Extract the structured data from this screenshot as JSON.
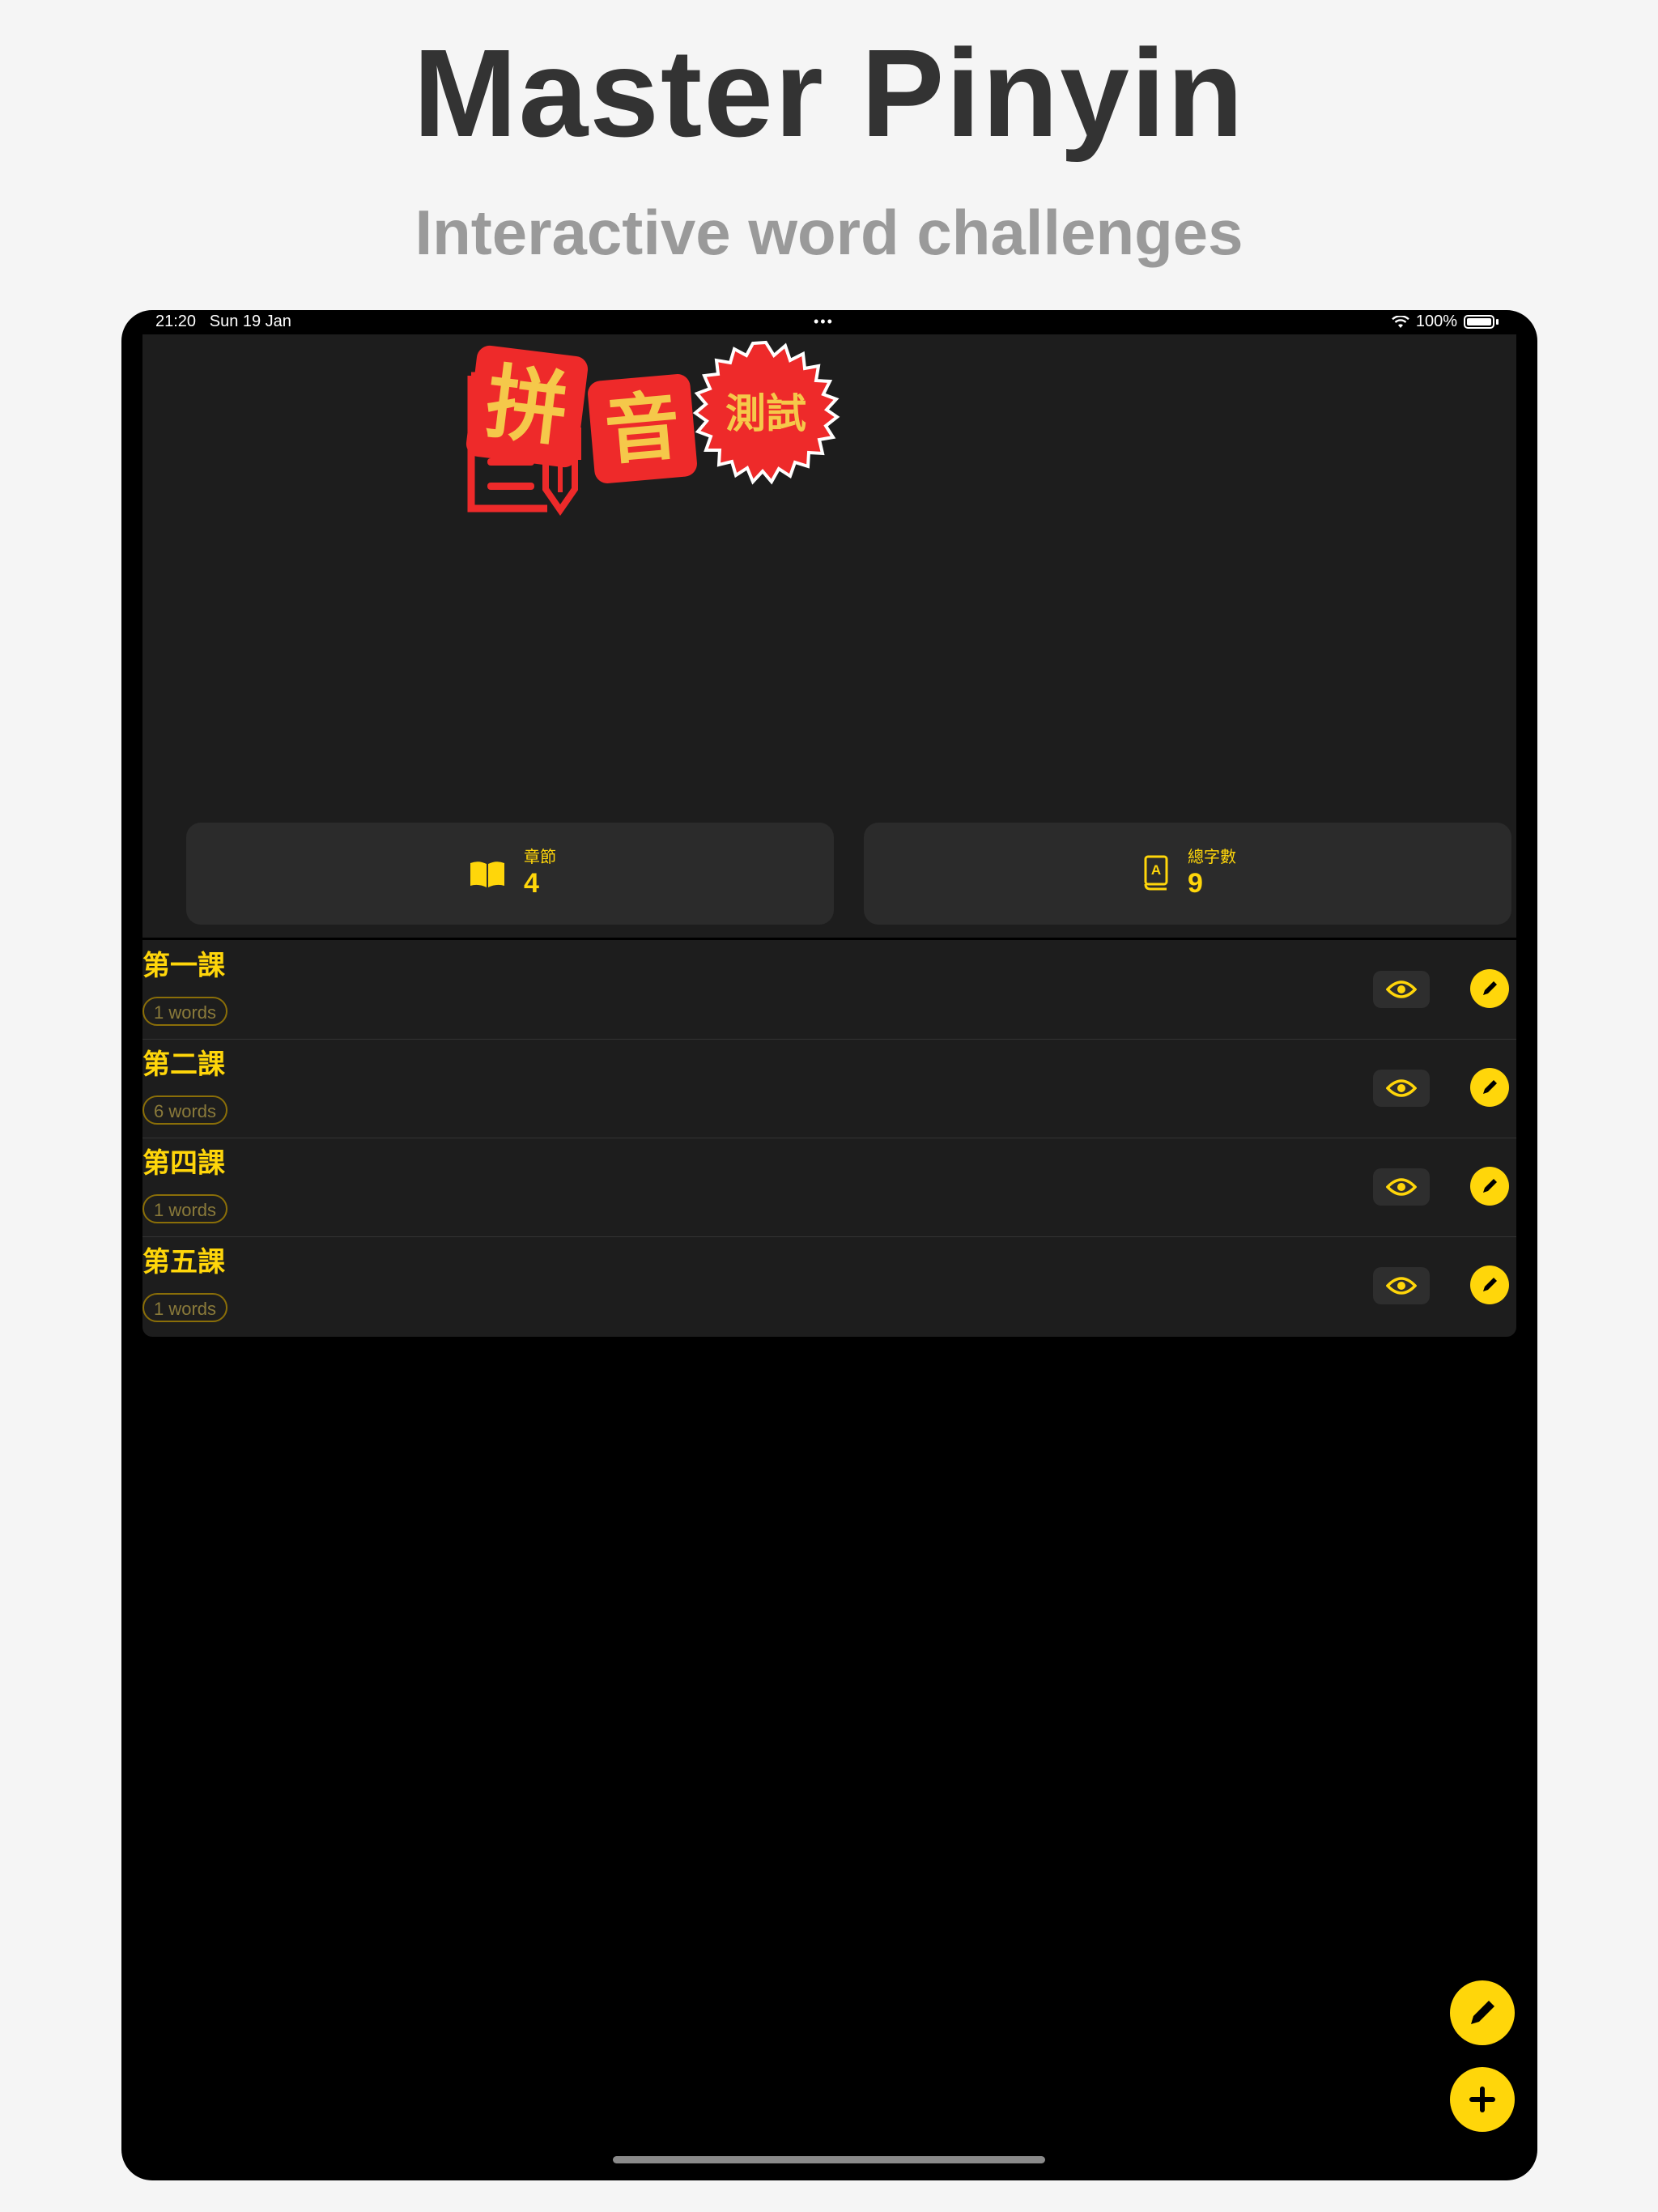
{
  "promo": {
    "title": "Master Pinyin",
    "subtitle": "Interactive word challenges"
  },
  "status_bar": {
    "time": "21:20",
    "date": "Sun 19 Jan",
    "battery": "100%"
  },
  "logo": {
    "tile_1": "拼",
    "tile_2": "音",
    "seal": "測試"
  },
  "stats": {
    "chapters": {
      "label": "章節",
      "value": "4",
      "icon": "book-icon"
    },
    "total_words": {
      "label": "總字數",
      "value": "9",
      "icon": "dictionary-icon"
    }
  },
  "lessons": [
    {
      "title": "第一課",
      "badge": "1 words"
    },
    {
      "title": "第二課",
      "badge": "6 words"
    },
    {
      "title": "第四課",
      "badge": "1 words"
    },
    {
      "title": "第五課",
      "badge": "1 words"
    }
  ],
  "colors": {
    "accent": "#ffd60a",
    "logo_red": "#ee2a2a",
    "background": "#000000",
    "panel": "#1d1d1d"
  }
}
